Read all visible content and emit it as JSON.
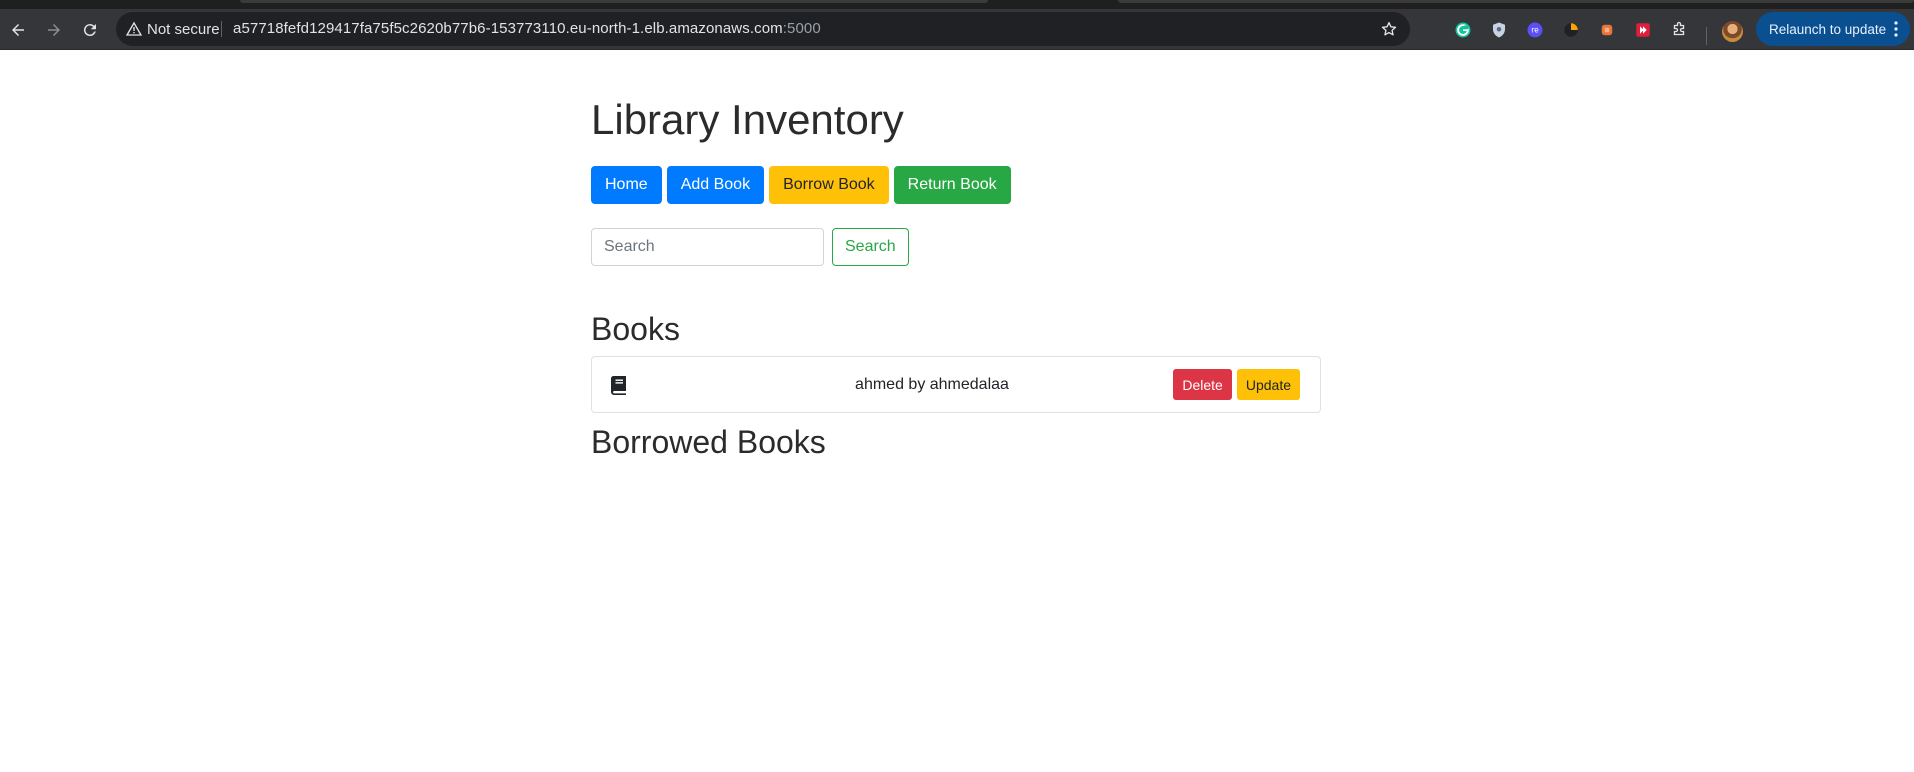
{
  "browser": {
    "security_label": "Not secure",
    "url_host": "a57718fefd129417fa75f5c2620b77b6-153773110.eu-north-1.elb.amazonaws.com",
    "url_port": ":5000",
    "relaunch_label": "Relaunch to update",
    "extensions": [
      "grammarly-icon",
      "shield-extension-icon",
      "re-extension-icon",
      "clock-extension-icon",
      "orange-extension-icon",
      "red-extension-icon",
      "puzzle-icon"
    ]
  },
  "page": {
    "title": "Library Inventory",
    "nav": {
      "home": "Home",
      "add_book": "Add Book",
      "borrow_book": "Borrow Book",
      "return_book": "Return Book"
    },
    "search": {
      "placeholder": "Search",
      "button": "Search"
    },
    "books_heading": "Books",
    "books": [
      {
        "text": "ahmed by ahmedalaa",
        "delete_label": "Delete",
        "update_label": "Update"
      }
    ],
    "borrowed_heading": "Borrowed Books"
  },
  "colors": {
    "primary": "#007bff",
    "warning": "#ffc107",
    "success": "#28a745",
    "danger": "#dc3545"
  }
}
